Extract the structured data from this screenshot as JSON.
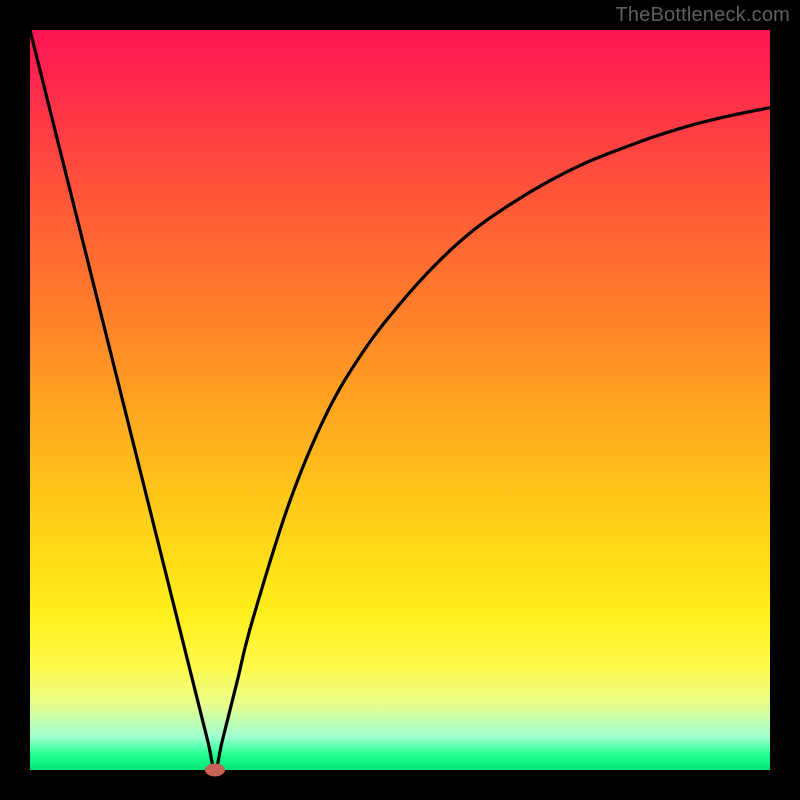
{
  "watermark": "TheBottleneck.com",
  "chart_data": {
    "type": "line",
    "title": "",
    "xlabel": "",
    "ylabel": "",
    "xlim": [
      0,
      100
    ],
    "ylim": [
      0,
      100
    ],
    "grid": false,
    "legend": false,
    "series": [
      {
        "name": "curve",
        "x": [
          0,
          5,
          10,
          15,
          20,
          22,
          24,
          25,
          26,
          28,
          30,
          35,
          40,
          45,
          50,
          55,
          60,
          65,
          70,
          75,
          80,
          85,
          90,
          95,
          100
        ],
        "y": [
          100,
          80,
          60,
          40,
          20,
          12,
          4,
          0,
          4,
          12,
          20,
          36,
          48,
          56.5,
          63,
          68.5,
          73,
          76.5,
          79.5,
          82,
          84,
          85.8,
          87.3,
          88.5,
          89.5
        ]
      }
    ],
    "marker": {
      "x": 25,
      "y": 0
    },
    "gradient_stops": [
      {
        "pos": 0.0,
        "color": "#ff1455"
      },
      {
        "pos": 0.5,
        "color": "#ffb020"
      },
      {
        "pos": 0.85,
        "color": "#fff94a"
      },
      {
        "pos": 1.0,
        "color": "#00e676"
      }
    ]
  }
}
